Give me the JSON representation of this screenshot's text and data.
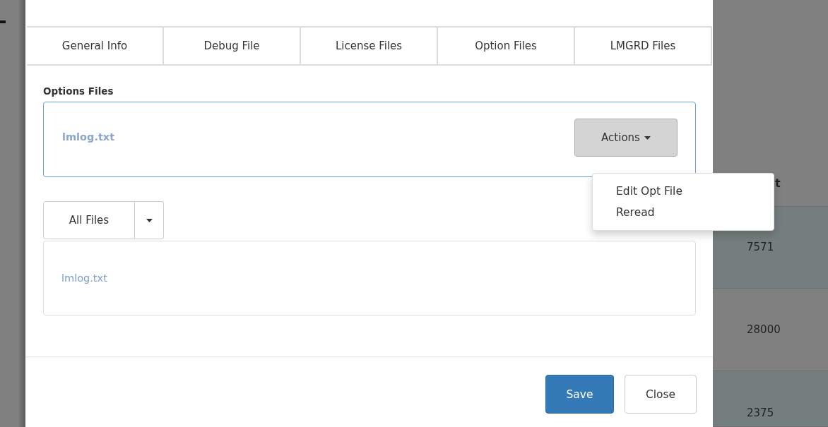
{
  "tabs": [
    {
      "label": "General Info",
      "selected": false
    },
    {
      "label": "Debug File",
      "selected": false
    },
    {
      "label": "License Files",
      "selected": false
    },
    {
      "label": "Option Files",
      "selected": false
    },
    {
      "label": "LMGRD Files",
      "selected": false
    }
  ],
  "options_files": {
    "heading": "Options Files",
    "file": "lmlog.txt",
    "actions_button": "Actions",
    "actions_menu": [
      "Edit Opt File",
      "Reread"
    ]
  },
  "file_filter": {
    "label": "All Files",
    "file": "lmlog.txt"
  },
  "footer": {
    "save": "Save",
    "close": "Close"
  },
  "background_table": {
    "header": "t",
    "rows": [
      "7571",
      "28000",
      "2375"
    ]
  }
}
